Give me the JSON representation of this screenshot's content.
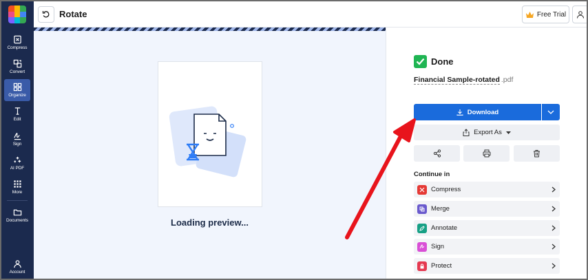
{
  "header": {
    "title": "Rotate",
    "free_trial_label": "Free Trial"
  },
  "sidebar": {
    "items": [
      {
        "label": "Compress",
        "icon": "compress-icon"
      },
      {
        "label": "Convert",
        "icon": "convert-icon"
      },
      {
        "label": "Organize",
        "icon": "organize-icon",
        "active": true
      },
      {
        "label": "Edit",
        "icon": "edit-text-icon"
      },
      {
        "label": "Sign",
        "icon": "signature-icon"
      },
      {
        "label": "AI PDF",
        "icon": "sparkle-icon"
      },
      {
        "label": "More",
        "icon": "grid-dots-icon"
      },
      {
        "label": "Documents",
        "icon": "folder-icon"
      },
      {
        "label": "Account",
        "icon": "user-icon"
      }
    ]
  },
  "preview": {
    "loading_text": "Loading preview..."
  },
  "result": {
    "status": "Done",
    "file_name": "Financial Sample-rotated",
    "file_ext": ".pdf",
    "download_label": "Download",
    "export_label": "Export As",
    "continue_title": "Continue in",
    "continue_items": [
      {
        "label": "Compress",
        "color": "#e53935"
      },
      {
        "label": "Merge",
        "color": "#6a5acd"
      },
      {
        "label": "Annotate",
        "color": "#17a085"
      },
      {
        "label": "Sign",
        "color": "#d94fd6"
      },
      {
        "label": "Protect",
        "color": "#e53950"
      }
    ]
  },
  "colors": {
    "sidebar_bg": "#1b2a4e",
    "accent": "#1a6bdc",
    "success": "#1fb553",
    "annotation_arrow": "#e8141c"
  }
}
